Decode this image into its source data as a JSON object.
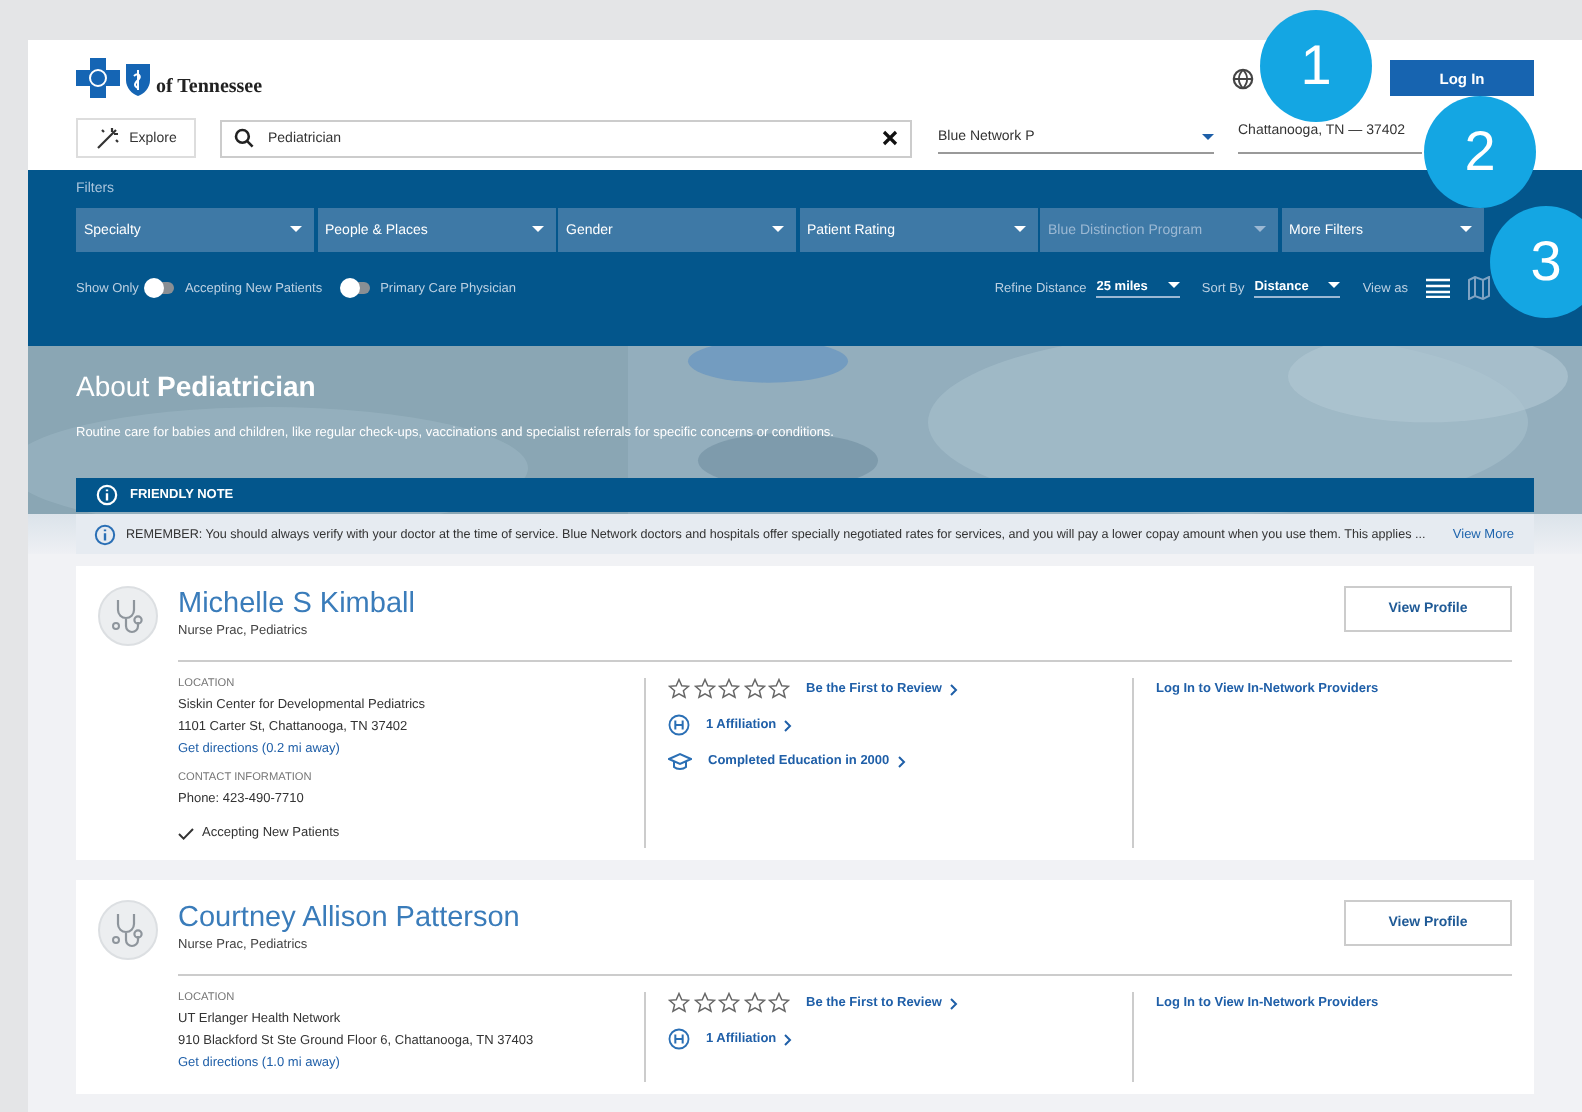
{
  "header": {
    "logo_text": "of Tennessee",
    "login_button": "Log In"
  },
  "search": {
    "explore_button": "Explore",
    "query": "Pediatrician",
    "network": "Blue Network P",
    "location": "Chattanooga, TN — 37402"
  },
  "filters": {
    "label": "Filters",
    "dropdowns": [
      {
        "label": "Specialty",
        "disabled": false
      },
      {
        "label": "People & Places",
        "disabled": false
      },
      {
        "label": "Gender",
        "disabled": false
      },
      {
        "label": "Patient Rating",
        "disabled": false
      },
      {
        "label": "Blue Distinction Program",
        "disabled": true
      },
      {
        "label": "More Filters",
        "disabled": false
      }
    ],
    "show_only_label": "Show Only",
    "toggles": [
      {
        "label": "Accepting New Patients",
        "on": false
      },
      {
        "label": "Primary Care Physician",
        "on": false
      }
    ],
    "refine_distance": {
      "label": "Refine Distance",
      "value": "25 miles"
    },
    "sort_by": {
      "label": "Sort By",
      "value": "Distance"
    },
    "view_as": {
      "label": "View as",
      "options": [
        {
          "kind": "list",
          "selected": true
        },
        {
          "kind": "map",
          "selected": false
        }
      ]
    }
  },
  "about": {
    "title_prefix": "About",
    "title_term": "Pediatrician",
    "description": "Routine care for babies and children, like regular check-ups, vaccinations and specialist referrals for specific concerns or conditions."
  },
  "note": {
    "heading": "FRIENDLY NOTE",
    "text": "REMEMBER: You should always verify with your doctor at the time of service. Blue Network doctors and hospitals offer specially negotiated rates for services, and you will pay a lower copay amount when you use them. This applies ...",
    "link": "View More"
  },
  "providers": [
    {
      "name": "Michelle S Kimball",
      "specialty": "Nurse Prac, Pediatrics",
      "location_label": "LOCATION",
      "facility": "Siskin Center for Developmental Pediatrics",
      "address": "1101 Carter St, Chattanooga, TN 37402",
      "directions": "Get directions (0.2 mi away)",
      "contact_label": "CONTACT INFORMATION",
      "phone": "Phone: 423-490-7710",
      "accepting": "Accepting New Patients",
      "stars": 0,
      "review_link": "Be the First to Review",
      "affiliation": "1 Affiliation",
      "education": "Completed Education in 2000",
      "network_link": "Log In to View In-Network Providers",
      "profile_button": "View Profile"
    },
    {
      "name": "Courtney Allison Patterson",
      "specialty": "Nurse Prac, Pediatrics",
      "location_label": "LOCATION",
      "facility": "UT Erlanger Health Network",
      "address": "910 Blackford St Ste Ground Floor 6, Chattanooga, TN 37403",
      "directions": "Get directions (1.0 mi away)",
      "stars": 0,
      "review_link": "Be the First to Review",
      "affiliation": "1 Affiliation",
      "network_link": "Log In to View In-Network Providers",
      "profile_button": "View Profile"
    }
  ],
  "callouts": [
    "1",
    "2",
    "3"
  ]
}
